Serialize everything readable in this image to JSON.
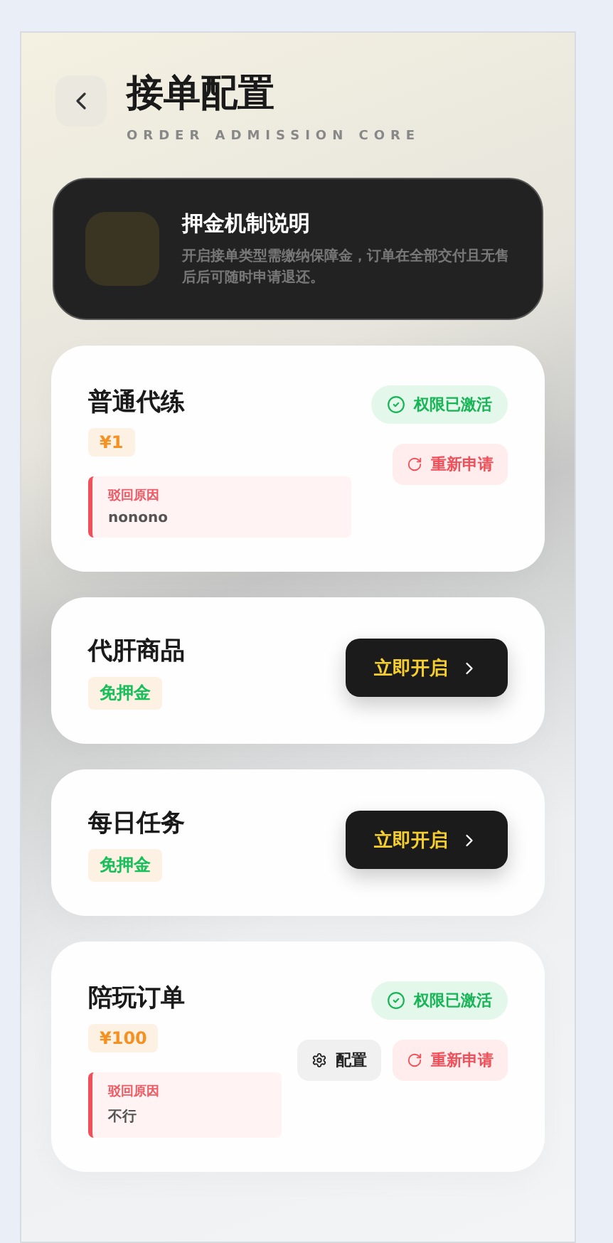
{
  "header": {
    "title": "接单配置",
    "subtitle": "ORDER ADMISSION CORE"
  },
  "info": {
    "title": "押金机制说明",
    "text": "开启接单类型需缴纳保障金，订单在全部交付且无售后后可随时申请退还。"
  },
  "cards": [
    {
      "kind": "active",
      "title": "普通代练",
      "tag": {
        "kind": "price",
        "text": "¥1"
      },
      "status": "权限已激活",
      "reapply_button": "重新申请",
      "reject": {
        "label": "驳回原因",
        "reason": "nonono"
      }
    },
    {
      "kind": "inactive",
      "title": "代肝商品",
      "tag": {
        "kind": "free",
        "text": "免押金"
      },
      "enable_button": "立即开启"
    },
    {
      "kind": "inactive",
      "title": "每日任务",
      "tag": {
        "kind": "free",
        "text": "免押金"
      },
      "enable_button": "立即开启"
    },
    {
      "kind": "active",
      "title": "陪玩订单",
      "tag": {
        "kind": "price",
        "text": "¥100"
      },
      "status": "权限已激活",
      "config_button": "配置",
      "reapply_button": "重新申请",
      "reject": {
        "label": "驳回原因",
        "reason": "不行"
      }
    }
  ]
}
